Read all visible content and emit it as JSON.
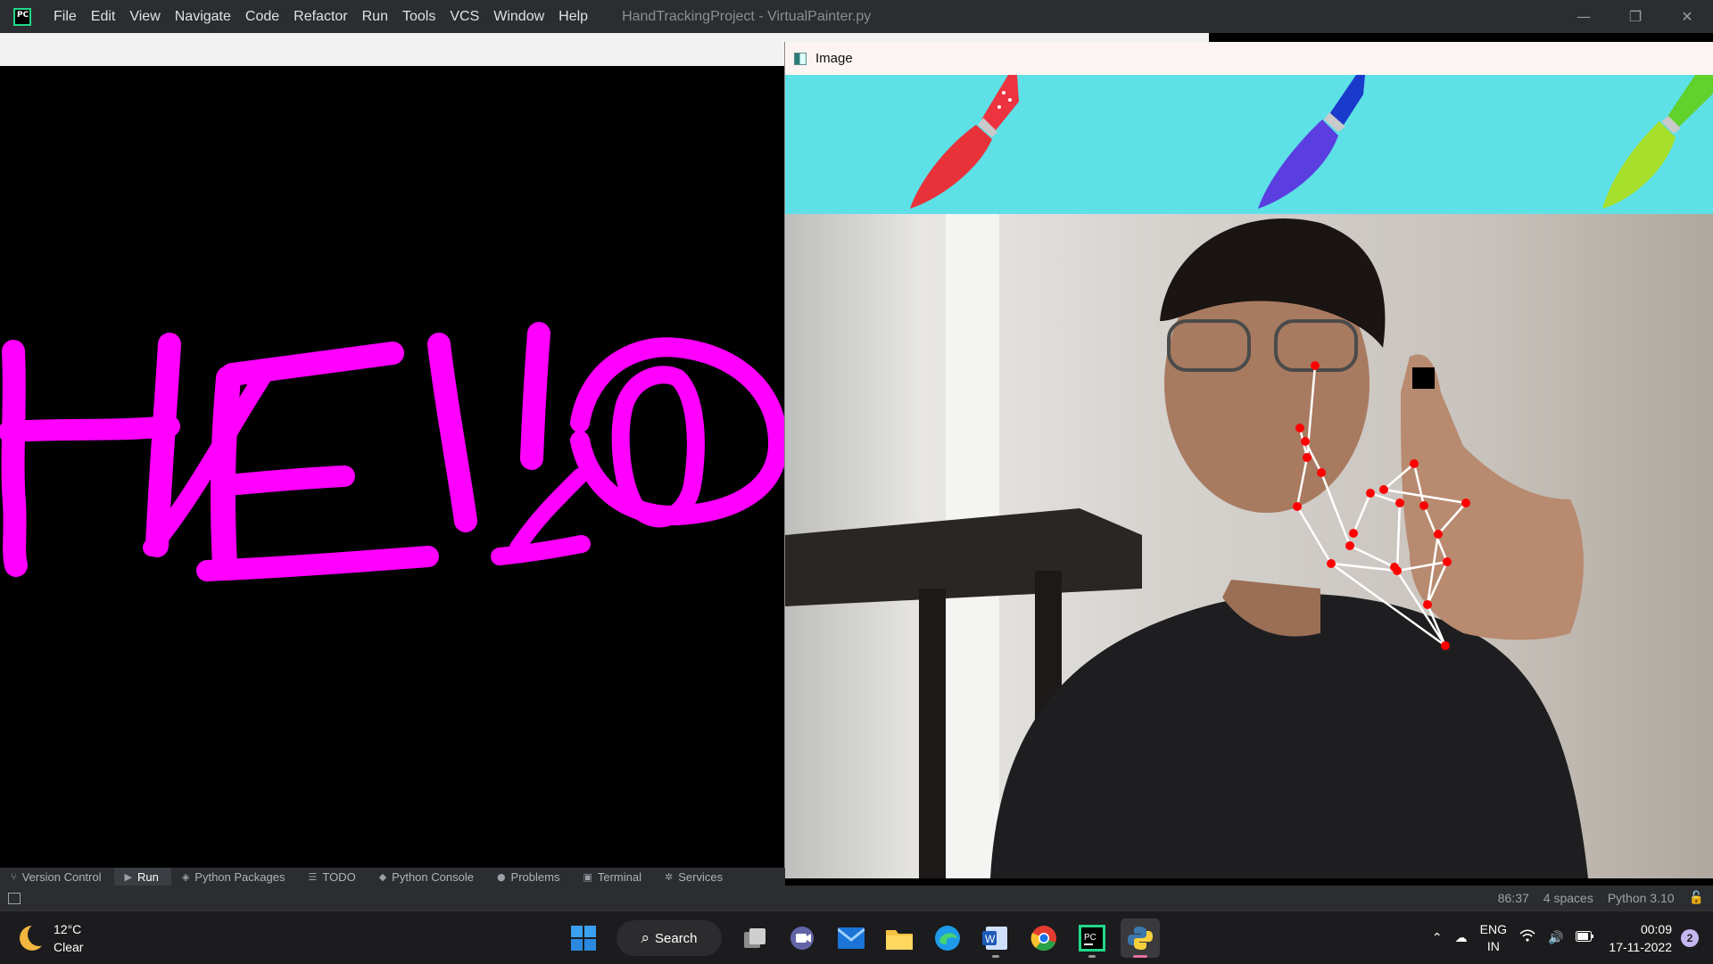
{
  "ide": {
    "logo_text": "PC",
    "menu": [
      "File",
      "Edit",
      "View",
      "Navigate",
      "Code",
      "Refactor",
      "Run",
      "Tools",
      "VCS",
      "Window",
      "Help"
    ],
    "window_title": "HandTrackingProject - VirtualPainter.py",
    "window_controls": {
      "minimize": "—",
      "restore": "❐",
      "close": "✕"
    }
  },
  "canvas": {
    "drawn_text": "HELLO",
    "stroke_color": "#ff00ff",
    "background": "#000000"
  },
  "image_window": {
    "title": "Image",
    "palette_background": "#5de0e6",
    "brushes": [
      {
        "name": "red-brush",
        "color": "#e8323a"
      },
      {
        "name": "blue-brush",
        "color": "#5a3ee0"
      },
      {
        "name": "green-brush",
        "color": "#a6de2c"
      }
    ],
    "landmark_color": "#ff0000",
    "connection_color": "#ffffff"
  },
  "tool_tabs": [
    {
      "label": "Version Control",
      "icon": "branch-icon",
      "glyph": "⑂",
      "active": false
    },
    {
      "label": "Run",
      "icon": "run-icon",
      "glyph": "▶",
      "active": true
    },
    {
      "label": "Python Packages",
      "icon": "packages-icon",
      "glyph": "◈",
      "active": false
    },
    {
      "label": "TODO",
      "icon": "list-icon",
      "glyph": "☰",
      "active": false
    },
    {
      "label": "Python Console",
      "icon": "console-icon",
      "glyph": "◆",
      "active": false
    },
    {
      "label": "Problems",
      "icon": "problems-icon",
      "glyph": "●",
      "active": false
    },
    {
      "label": "Terminal",
      "icon": "terminal-icon",
      "glyph": "▣",
      "active": false
    },
    {
      "label": "Services",
      "icon": "services-icon",
      "glyph": "✲",
      "active": false
    }
  ],
  "status_bar": {
    "position": "86:37",
    "indent": "4 spaces",
    "interpreter": "Python 3.10"
  },
  "taskbar": {
    "weather": {
      "temp": "12°C",
      "condition": "Clear"
    },
    "search_label": "Search",
    "apps": [
      "windows-start",
      "task-view",
      "teams-chat",
      "mail",
      "file-explorer",
      "edge",
      "word",
      "chrome",
      "pycharm",
      "python"
    ],
    "tray": {
      "language": "ENG",
      "region": "IN"
    },
    "clock": {
      "time": "00:09",
      "date": "17-11-2022"
    },
    "notifications": "2"
  }
}
